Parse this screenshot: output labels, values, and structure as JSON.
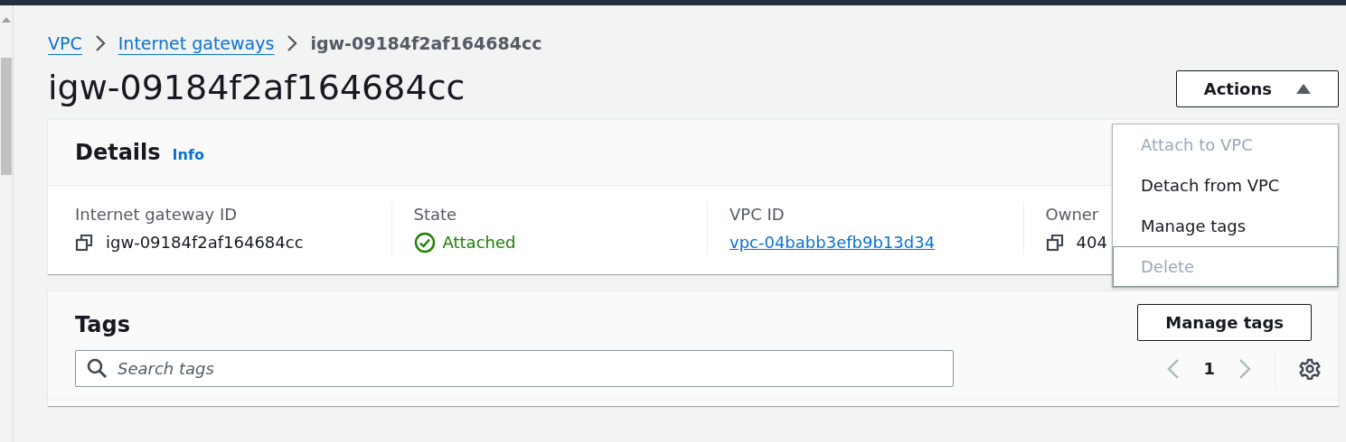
{
  "breadcrumbs": [
    {
      "label": "VPC",
      "link": true
    },
    {
      "label": "Internet gateways",
      "link": true
    },
    {
      "label": "igw-09184f2af164684cc",
      "link": false
    }
  ],
  "page_title": "igw-09184f2af164684cc",
  "actions": {
    "label": "Actions",
    "expanded": true,
    "menu": [
      {
        "label": "Attach to VPC",
        "disabled": true,
        "highlighted": false
      },
      {
        "label": "Detach from VPC",
        "disabled": false,
        "highlighted": false
      },
      {
        "label": "Manage tags",
        "disabled": false,
        "highlighted": false
      },
      {
        "label": "Delete",
        "disabled": true,
        "highlighted": true
      }
    ]
  },
  "details": {
    "title": "Details",
    "info": "Info",
    "fields": [
      {
        "label": "Internet gateway ID",
        "value": "igw-09184f2af164684cc",
        "kind": "copy"
      },
      {
        "label": "State",
        "value": "Attached",
        "kind": "status"
      },
      {
        "label": "VPC ID",
        "value": "vpc-04babb3efb9b13d34",
        "kind": "link"
      },
      {
        "label": "Owner",
        "value": "404",
        "kind": "copy"
      }
    ]
  },
  "tags": {
    "title": "Tags",
    "button": "Manage tags",
    "search": {
      "placeholder": "Search tags"
    },
    "page": "1"
  }
}
